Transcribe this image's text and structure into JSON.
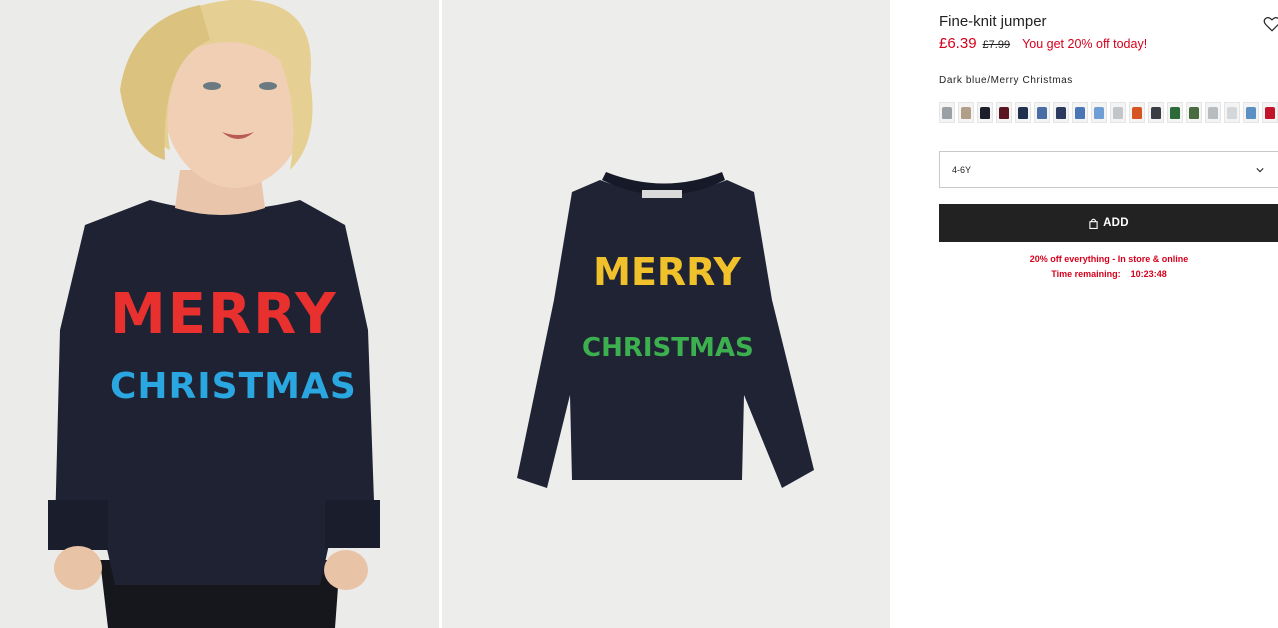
{
  "product": {
    "title": "Fine-knit jumper",
    "price_current": "£6.39",
    "price_original": "£7.99",
    "promo_text": "You get 20% off today!",
    "colour_label": "Dark blue/Merry Christmas",
    "size_selected": "4-6Y",
    "add_button_label": "ADD",
    "sale_line": "20% off everything - In store & online",
    "timer_label": "Time remaining:",
    "timer_value": "10:23:48"
  },
  "jumper_text": {
    "line1": "MERRY",
    "line2": "CHRISTMAS"
  },
  "swatches": [
    {
      "name": "grey-stripe",
      "color": "#9aa1a6"
    },
    {
      "name": "beige-stripe",
      "color": "#b29f8a"
    },
    {
      "name": "black-print",
      "color": "#1c1f2a"
    },
    {
      "name": "burgundy",
      "color": "#5a1520"
    },
    {
      "name": "navy-print",
      "color": "#22304f"
    },
    {
      "name": "blue-print",
      "color": "#4a6da6"
    },
    {
      "name": "navy-stripe",
      "color": "#2c3a60"
    },
    {
      "name": "multi-stripe",
      "color": "#4b76b5"
    },
    {
      "name": "blue-light-stripe",
      "color": "#6e9ed3"
    },
    {
      "name": "light-grey",
      "color": "#c3c6c8"
    },
    {
      "name": "orange",
      "color": "#d65422"
    },
    {
      "name": "dark-stripe",
      "color": "#3a3d44"
    },
    {
      "name": "green-print",
      "color": "#2d6a3a"
    },
    {
      "name": "khaki",
      "color": "#4a6b3e"
    },
    {
      "name": "grey-print",
      "color": "#b8bcbf"
    },
    {
      "name": "light-grey-print",
      "color": "#d4d7d9"
    },
    {
      "name": "blue-pattern",
      "color": "#5c8fc4"
    },
    {
      "name": "red",
      "color": "#c2152a"
    },
    {
      "name": "dark-blue-merry-christmas",
      "color": "#1f2334",
      "selected": true
    },
    {
      "name": "dark-grey",
      "color": "#5a5e64"
    }
  ],
  "colors": {
    "accent_red": "#d6001c",
    "button_bg": "#222222",
    "jumper": "#1f2334"
  },
  "icons": {
    "wishlist": "heart-icon",
    "dropdown": "chevron-down-icon",
    "bag": "bag-icon"
  }
}
